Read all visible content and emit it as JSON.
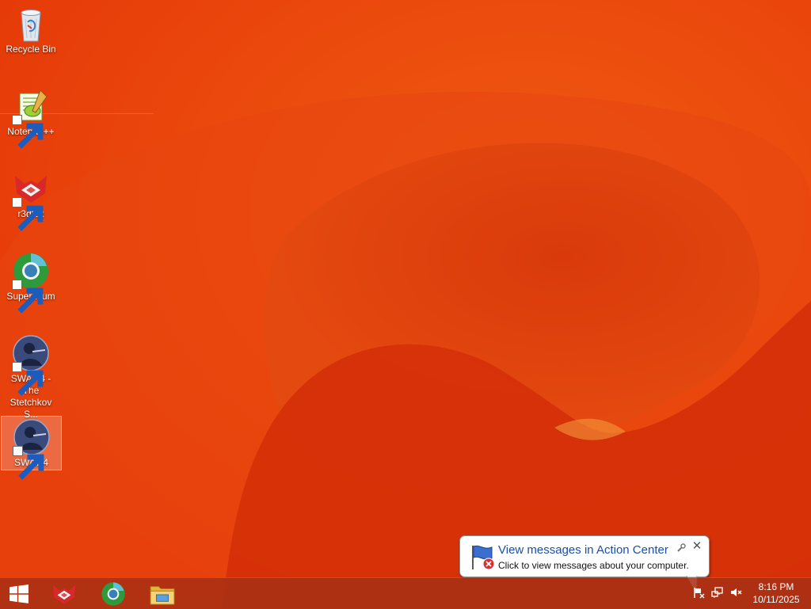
{
  "desktop": {
    "icons": [
      {
        "label": "Recycle Bin",
        "icon": "recycle-bin-icon"
      },
      {
        "label": "Notepad++",
        "icon": "notepadpp-icon"
      },
      {
        "label": "r3dfox",
        "icon": "r3dfox-icon"
      },
      {
        "label": "Supermium",
        "icon": "supermium-icon"
      },
      {
        "label": "SWAT 4 - The Stetchkov S...",
        "icon": "swat4-icon"
      },
      {
        "label": "SWAT 4",
        "icon": "swat4-icon"
      }
    ],
    "selected_icon": "SWAT 4"
  },
  "taskbar": {
    "start": "windows-logo-icon",
    "pinned": [
      "r3dfox-icon",
      "supermium-icon",
      "file-explorer-icon"
    ],
    "tray": [
      "action-center-flag-icon",
      "network-icon",
      "volume-muted-icon"
    ],
    "time": "8:16 PM",
    "date": "10/11/2025"
  },
  "notification": {
    "title": "View messages in Action Center",
    "message": "Click to view messages about your computer.",
    "icon": "action-center-flag-icon"
  },
  "colors": {
    "wallpaper_base": "#e8430a",
    "wallpaper_dark": "#c72a0a",
    "taskbar": "#a83014",
    "notification_title": "#1c4ea8"
  }
}
